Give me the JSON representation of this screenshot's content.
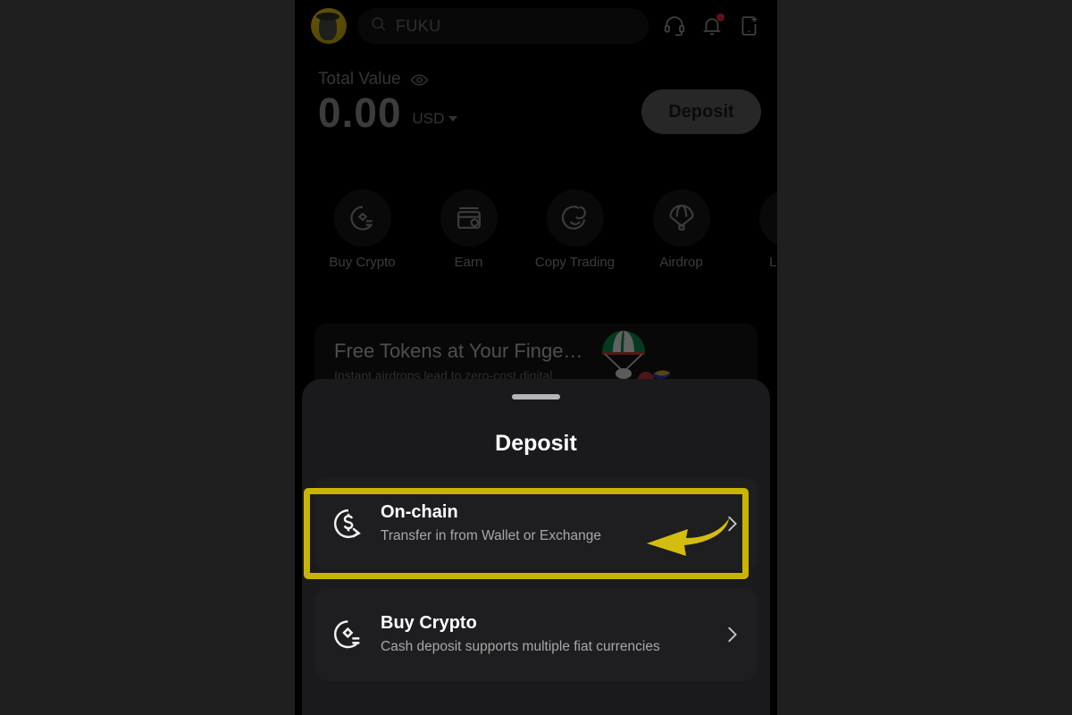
{
  "theme": {
    "page_background": "#1f1f1f",
    "phone_background": "#000000",
    "sheet_background": "#1a1a1c",
    "card_background": "#1e1e20",
    "highlight_color": "#c8b400",
    "arrow_color": "#d4bc10",
    "accent_avatar": "#d4b40c",
    "badge_color": "#e0274a"
  },
  "header": {
    "avatar_name": "user-avatar",
    "search": {
      "value": "FUKU",
      "icon": "search-icon"
    },
    "icons": [
      {
        "name": "support-headset-icon",
        "badge": false
      },
      {
        "name": "notification-bell-icon",
        "badge": true
      },
      {
        "name": "add-device-icon",
        "badge": false
      }
    ]
  },
  "balance": {
    "label": "Total Value",
    "visibility_icon": "eye-icon",
    "amount": "0.00",
    "currency": "USD",
    "currency_caret": "chevron-down-icon",
    "deposit_label": "Deposit"
  },
  "quick_actions": [
    {
      "label": "Buy Crypto",
      "icon": "buy-crypto-icon"
    },
    {
      "label": "Earn",
      "icon": "earn-card-icon"
    },
    {
      "label": "Copy Trading",
      "icon": "copy-trading-icon"
    },
    {
      "label": "Airdrop",
      "icon": "airdrop-parachute-icon"
    },
    {
      "label": "Launc",
      "icon": "launchpad-icon"
    }
  ],
  "banner": {
    "title": "Free Tokens at Your Finge…",
    "subtitle": "Instant airdrops lead to zero-cost digital",
    "graphic": "parachute-balloon-graphic"
  },
  "sheet": {
    "handle": "drag-handle",
    "title": "Deposit",
    "options": [
      {
        "id": "on-chain",
        "title": "On-chain",
        "subtitle": "Transfer in from Wallet or Exchange",
        "icon": "dollar-circle-arrow-icon",
        "chevron": "chevron-right-icon",
        "highlighted": true
      },
      {
        "id": "buy-crypto",
        "title": "Buy Crypto",
        "subtitle": "Cash deposit supports multiple fiat currencies",
        "icon": "buy-crypto-icon",
        "chevron": "chevron-right-icon",
        "highlighted": false
      }
    ]
  },
  "annotation": {
    "highlight_target": "on-chain",
    "arrow": "curved-left-arrow"
  }
}
